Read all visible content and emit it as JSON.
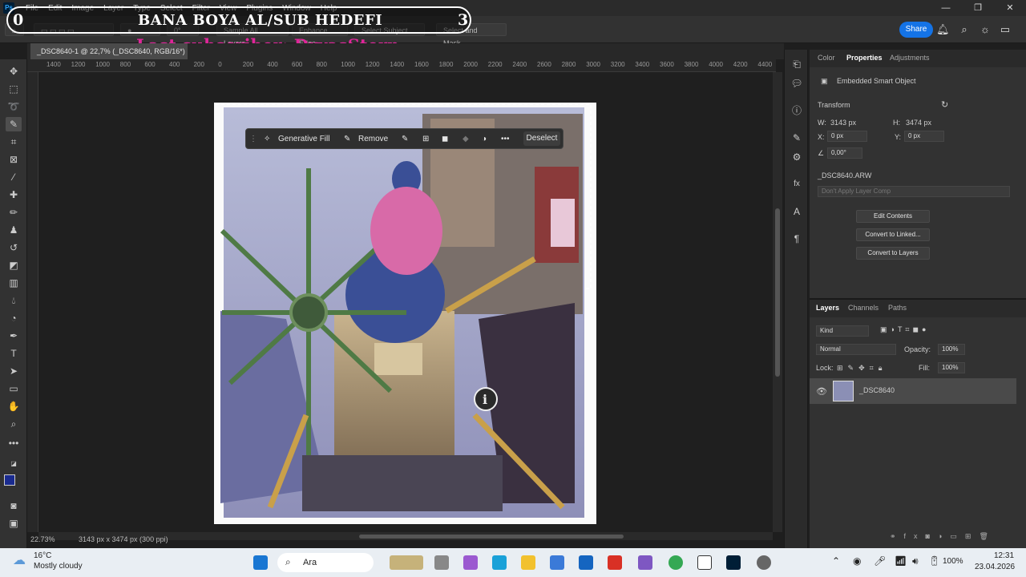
{
  "menu": {
    "logo": "Ps",
    "items": [
      "File",
      "Edit",
      "Image",
      "Layer",
      "Type",
      "Select",
      "Filter",
      "View",
      "Plugins",
      "Window",
      "Help"
    ]
  },
  "window_controls": [
    "—",
    "❐",
    "✕"
  ],
  "options_bar": {
    "angle": "0°",
    "sample_all_layers": "Sample All Layers",
    "enhance_edge": "Enhance Edge",
    "select_subject": "Select Subject",
    "select_and_mask": "Select and Mask..."
  },
  "top_right": {
    "share": "Share"
  },
  "overlay": {
    "left_num": "0",
    "title": "BANA BOYA AL/SUB HEDEFI",
    "right_num": "3",
    "last_sub": "Last subscriber: DryasStern"
  },
  "doc_tab": {
    "label": "_DSC8640-1 @ 22,7% (_DSC8640, RGB/16*)"
  },
  "ruler_ticks": [
    "1400",
    "1200",
    "1000",
    "800",
    "600",
    "400",
    "200",
    "0",
    "200",
    "400",
    "600",
    "800",
    "1000",
    "1200",
    "1400",
    "1600",
    "1800",
    "2000",
    "2200",
    "2400",
    "2600",
    "2800",
    "3000",
    "3200",
    "3400",
    "3600",
    "3800",
    "4000",
    "4200",
    "4400"
  ],
  "context_bar": {
    "generative_fill": "Generative Fill",
    "remove": "Remove",
    "more": "•••",
    "deselect": "Deselect"
  },
  "status": {
    "zoom": "22.73%",
    "dims": "3143 px x 3474 px (300 ppi)"
  },
  "properties": {
    "tabs": [
      "Color",
      "Properties",
      "Adjustments"
    ],
    "type": "Embedded Smart Object",
    "section": "Transform",
    "w_label": "W:",
    "w": "3143 px",
    "h_label": "H:",
    "h": "3474 px",
    "x_label": "X:",
    "x": "0 px",
    "y_label": "Y:",
    "y": "0 px",
    "angle": "0,00°",
    "file": "_DSC8640.ARW",
    "layer_comp": "Don't Apply Layer Comp",
    "btn_edit": "Edit Contents",
    "btn_linked": "Convert to Linked...",
    "btn_layers": "Convert to Layers"
  },
  "layers": {
    "tabs": [
      "Layers",
      "Channels",
      "Paths"
    ],
    "kind": "Kind",
    "blend": "Normal",
    "opacity_label": "Opacity:",
    "opacity": "100%",
    "lock_label": "Lock:",
    "fill_label": "Fill:",
    "fill": "100%",
    "layer_name": "_DSC8640"
  },
  "taskbar": {
    "temp": "16°C",
    "weather": "Mostly cloudy",
    "search": "Ara",
    "battery": "100%",
    "time": "12:31",
    "date": "23.04.2026"
  }
}
